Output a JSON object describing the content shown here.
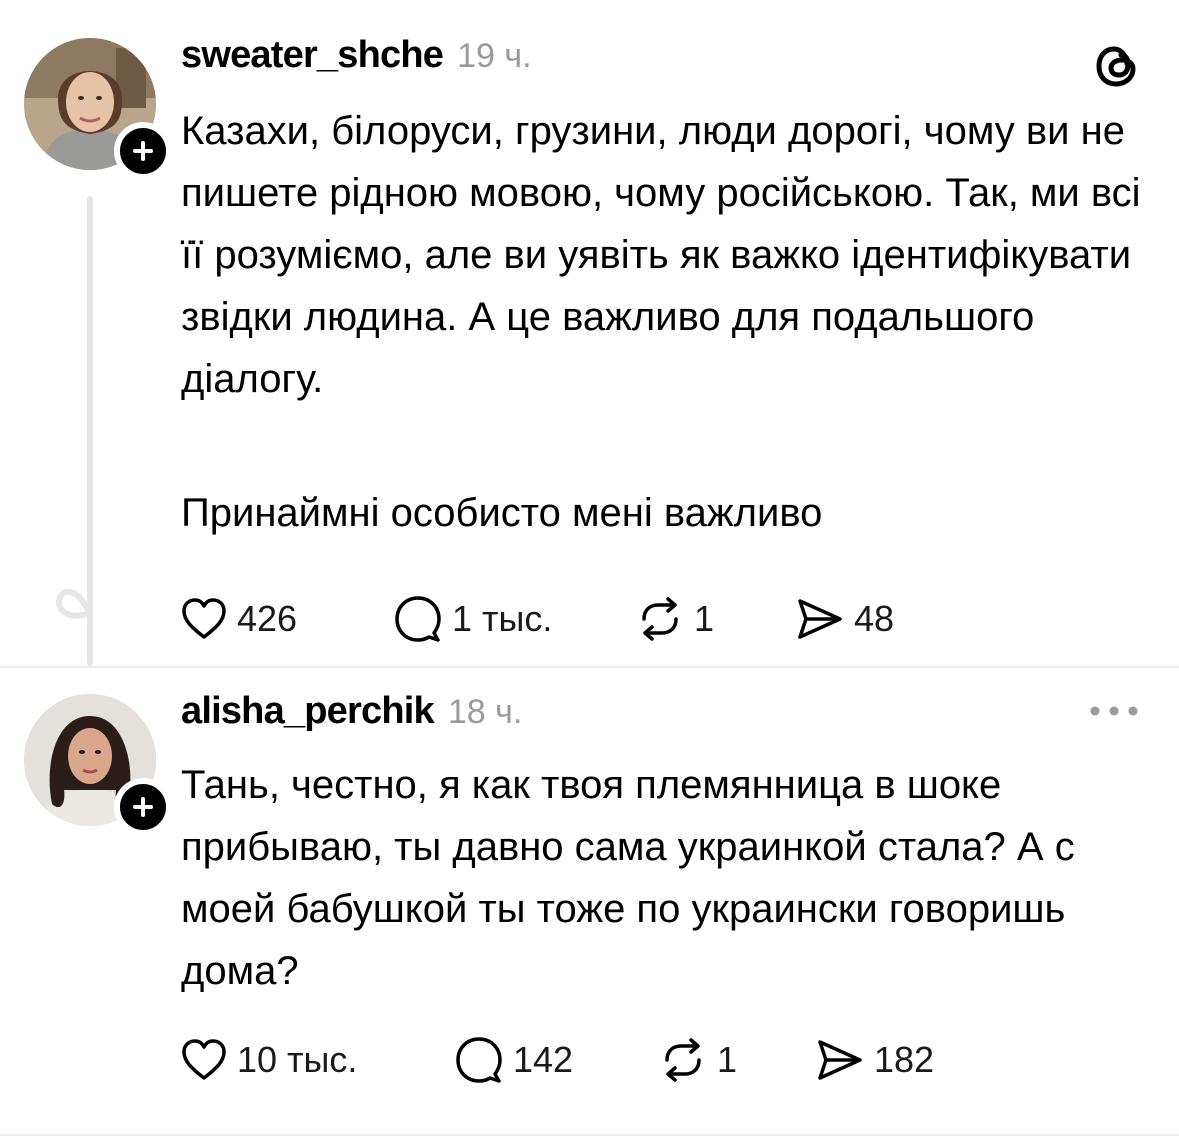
{
  "app": {
    "brand_icon": "threads-logo-icon",
    "accent": "#000000",
    "secondary_text": "#9a9a9a"
  },
  "posts": [
    {
      "username": "sweater_shche",
      "time": "19 ч.",
      "paragraphs": [
        "Казахи, білоруси, грузини, люди дорогі, чому ви не пишете рідною мовою, чому російською. Так, ми всі її розуміємо, але ви уявіть як важко ідентифікувати звідки людина. А це важливо для подальшого діалогу.",
        "Принаймні особисто мені важливо"
      ],
      "likes": "426",
      "replies": "1 тыс.",
      "reposts": "1",
      "shares": "48"
    },
    {
      "username": "alisha_perchik",
      "time": "18 ч.",
      "paragraphs": [
        "Тань, честно, я как твоя племянница в шоке прибываю, ты давно сама украинкой стала? А с моей бабушкой ты тоже по украински говоришь дома?"
      ],
      "likes": "10 тыс.",
      "replies": "142",
      "reposts": "1",
      "shares": "182"
    }
  ]
}
